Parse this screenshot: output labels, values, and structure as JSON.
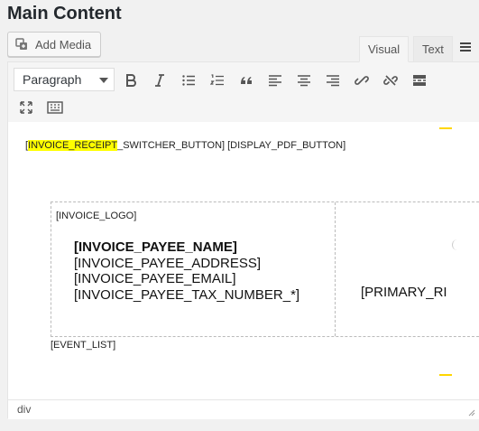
{
  "page": {
    "title": "Main Content"
  },
  "media": {
    "add_label": "Add Media",
    "icon": "add-media-icon"
  },
  "tabs": {
    "visual": "Visual",
    "text": "Text",
    "active": "Visual"
  },
  "toolbar": {
    "format_value": "Paragraph",
    "buttons": [
      "bold-icon",
      "italic-icon",
      "bullet-list-icon",
      "numbered-list-icon",
      "blockquote-icon",
      "align-left-icon",
      "align-center-icon",
      "align-right-icon",
      "insert-link-icon",
      "remove-link-icon",
      "read-more-icon",
      "fullscreen-icon",
      "toolbar-toggle-icon"
    ]
  },
  "content": {
    "shortcode_open": "[",
    "shortcode_highlight": "INVOICE_RECEIPT",
    "shortcode_rest": "_SWITCHER_BUTTON] [DISPLAY_PDF_BUTTON]",
    "logo": "[INVOICE_LOGO]",
    "payee_name": "[INVOICE_PAYEE_NAME]",
    "payee_address": "[INVOICE_PAYEE_ADDRESS]",
    "payee_email": "[INVOICE_PAYEE_EMAIL]",
    "payee_tax": "[INVOICE_PAYEE_TAX_NUMBER_*]",
    "primary": "[PRIMARY_RI",
    "event_list": "[EVENT_LIST]"
  },
  "status": {
    "path": "div"
  },
  "colors": {
    "highlight": "#ffff00",
    "marker": "#ffd600"
  }
}
